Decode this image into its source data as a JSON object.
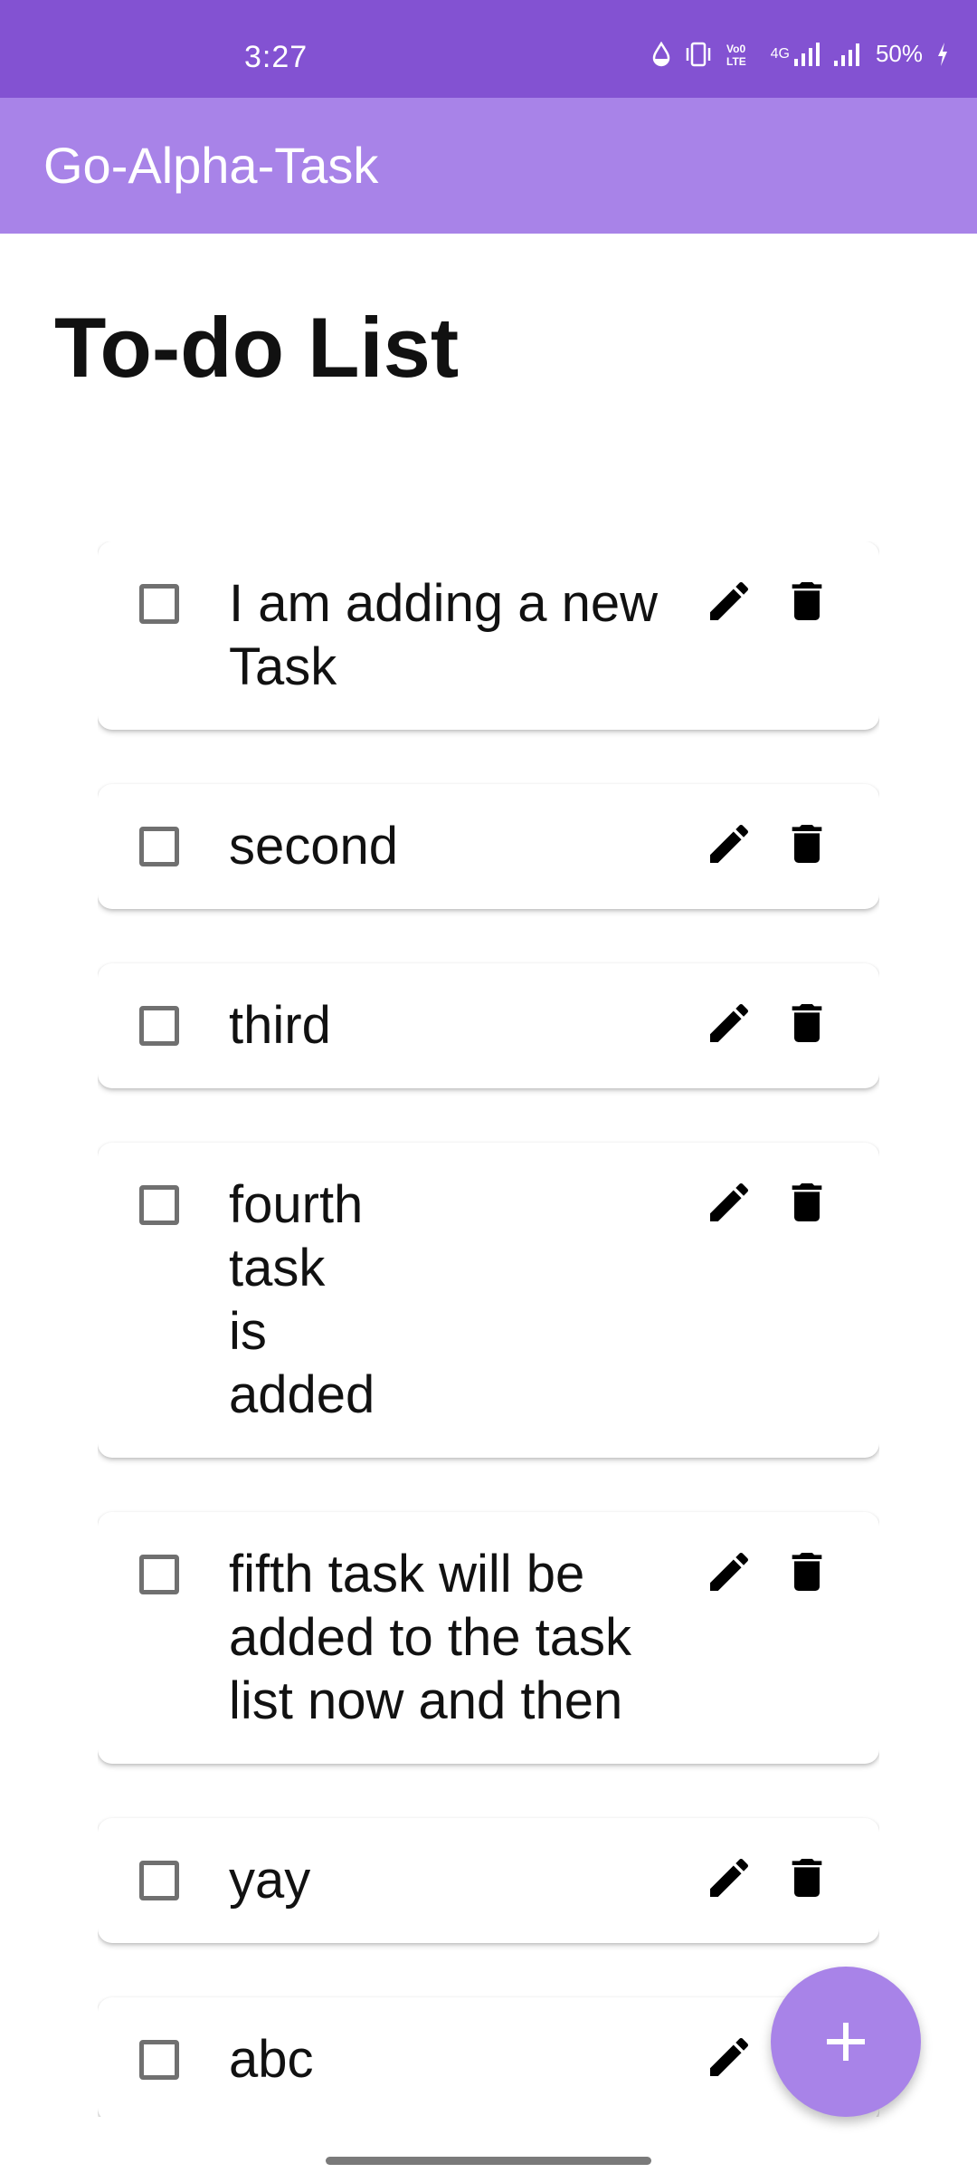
{
  "status_bar": {
    "time": "3:27",
    "net_label": "4G",
    "battery": "50%",
    "icons": [
      "data-saver-icon",
      "vibrate-icon",
      "volte-icon",
      "signal-4g-icon",
      "signal-icon",
      "battery-charging-icon"
    ]
  },
  "app_bar": {
    "title": "Go-Alpha-Task"
  },
  "page": {
    "title": "To-do List"
  },
  "tasks": [
    {
      "text": "I am adding a new\nTask",
      "checked": false
    },
    {
      "text": "second",
      "checked": false
    },
    {
      "text": "third",
      "checked": false
    },
    {
      "text": "fourth\ntask\nis\nadded",
      "checked": false
    },
    {
      "text": "fifth task will be\nadded to the task\nlist now and then",
      "checked": false
    },
    {
      "text": "yay",
      "checked": false
    },
    {
      "text": "abc",
      "checked": false
    }
  ],
  "task_actions": {
    "edit_icon": "pencil-icon",
    "delete_icon": "trash-icon"
  },
  "fab": {
    "icon": "plus-icon",
    "label": "+"
  },
  "colors": {
    "status_bar": "#8352d2",
    "app_bar": "#a883e8",
    "fab": "#a883e8"
  }
}
